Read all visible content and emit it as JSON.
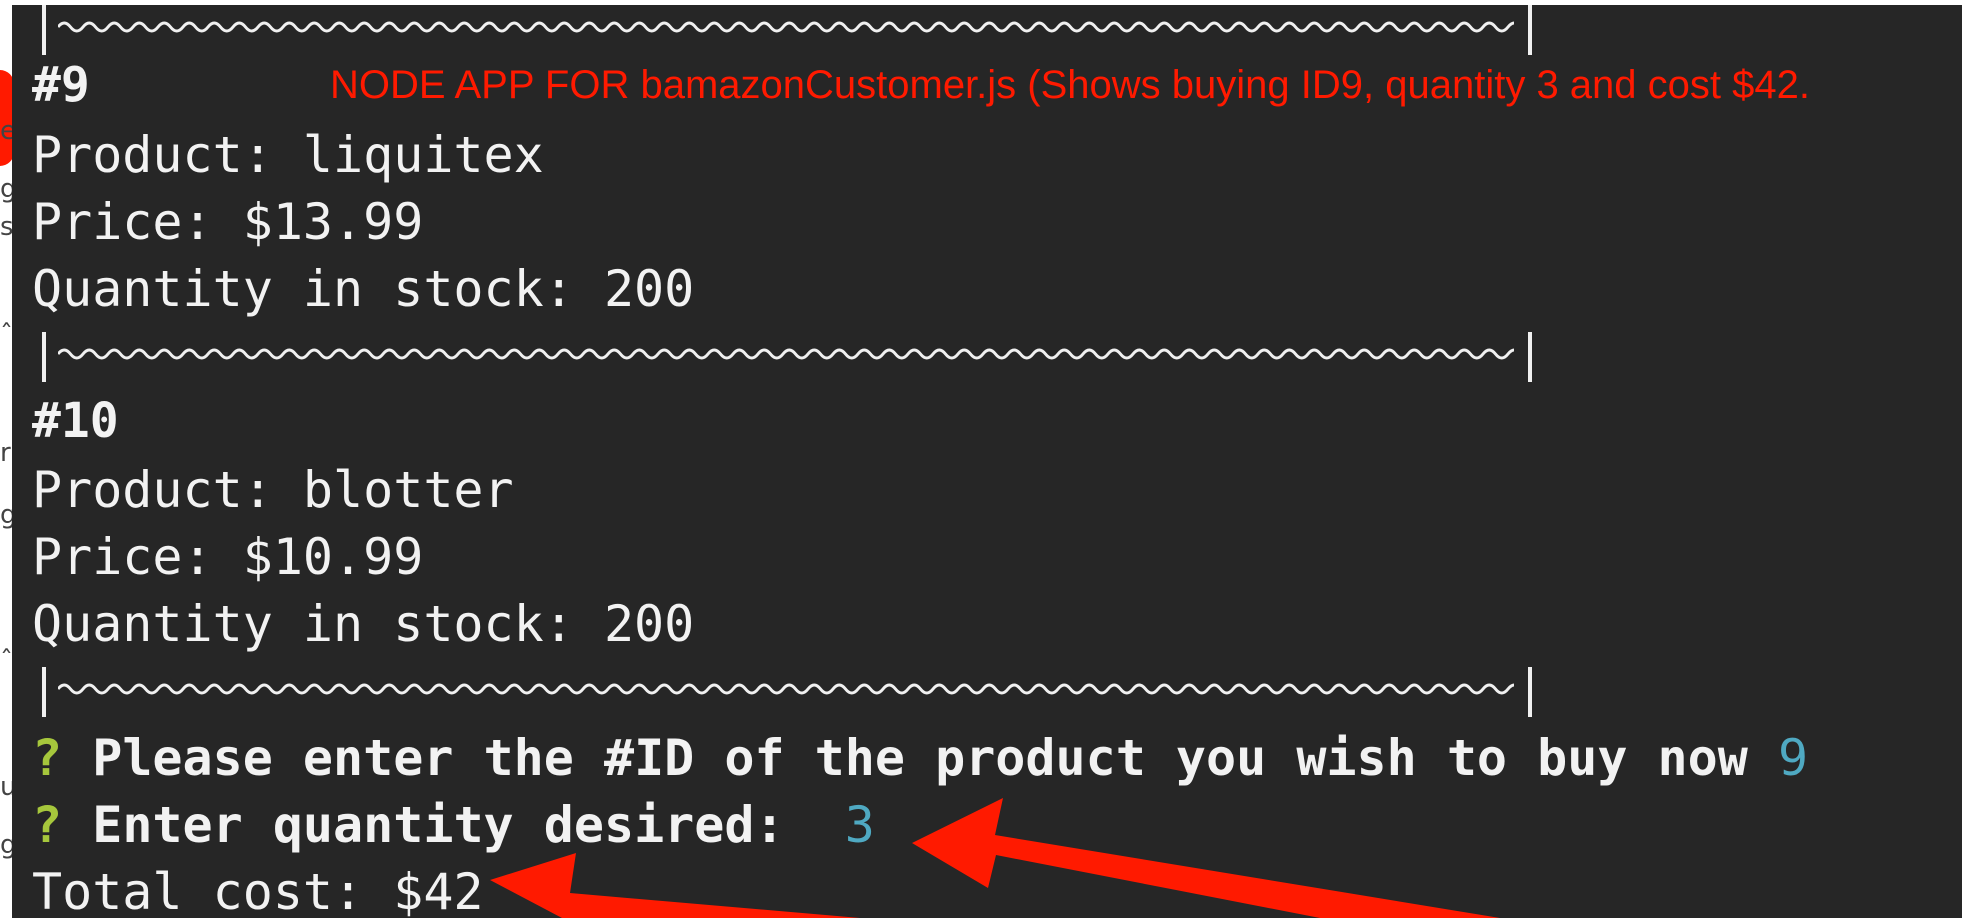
{
  "annotation": {
    "text": "NODE APP FOR bamazonCustomer.js (Shows  buying ID9, quantity 3 and cost $42."
  },
  "products": [
    {
      "id_label": "#9",
      "product_line": "Product: liquitex",
      "price_line": "Price: $13.99",
      "stock_line": "Quantity in stock: 200"
    },
    {
      "id_label": "#10",
      "product_line": "Product: blotter",
      "price_line": "Price: $10.99",
      "stock_line": "Quantity in stock: 200"
    }
  ],
  "prompts": [
    {
      "marker": "?",
      "question": "Please enter the #ID of the product you wish to buy now",
      "answer": "9"
    },
    {
      "marker": "?",
      "question": "Enter quantity desired: ",
      "answer": "3"
    }
  ],
  "result": {
    "total_line": "Total cost: $42"
  },
  "colors": {
    "background": "#262626",
    "text": "#f2f2f2",
    "prompt_marker": "#a6c73c",
    "answer": "#4fa9c2",
    "annotation": "#ff1a00"
  }
}
